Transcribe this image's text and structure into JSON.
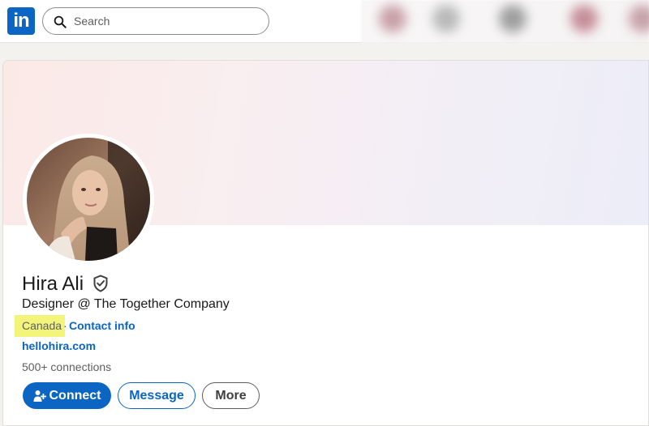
{
  "nav": {
    "logo_text": "in",
    "search_placeholder": "Search",
    "search_icon": "search-icon"
  },
  "profile": {
    "name": "Hira Ali",
    "verified_icon": "verified-shield-icon",
    "headline": "Designer @ The Together Company",
    "location": "Canada",
    "separator": "·",
    "contact_info": "Contact info",
    "website": "hellohira.com",
    "connections": "500+ connections"
  },
  "actions": {
    "connect": "Connect",
    "message": "Message",
    "more": "More"
  },
  "colors": {
    "brand": "#0a66c2",
    "highlight": "#f3f57a"
  }
}
